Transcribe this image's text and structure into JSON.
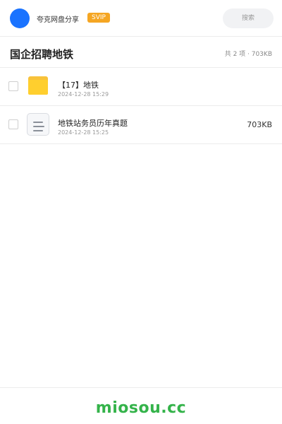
{
  "header": {
    "brand_name": "夸克网盘分享",
    "badge": "SVIP",
    "search_placeholder": "搜索"
  },
  "folder": {
    "title": "国企招聘地铁",
    "summary": "共 2 项 · 703KB"
  },
  "files": [
    {
      "icon": "folder-icon",
      "name": "【17】地铁",
      "date": "2024-12-28 15:29",
      "size": ""
    },
    {
      "icon": "document-icon",
      "name": "地铁站务员历年真题",
      "date": "2024-12-28 15:25",
      "size": "703KB"
    }
  ],
  "footer": {
    "watermark": "miosou.cc"
  },
  "colors": {
    "avatar": "#1a73ff",
    "badge": "#f5a623",
    "folder": "#ffcf2e",
    "watermark": "#34b34a"
  }
}
